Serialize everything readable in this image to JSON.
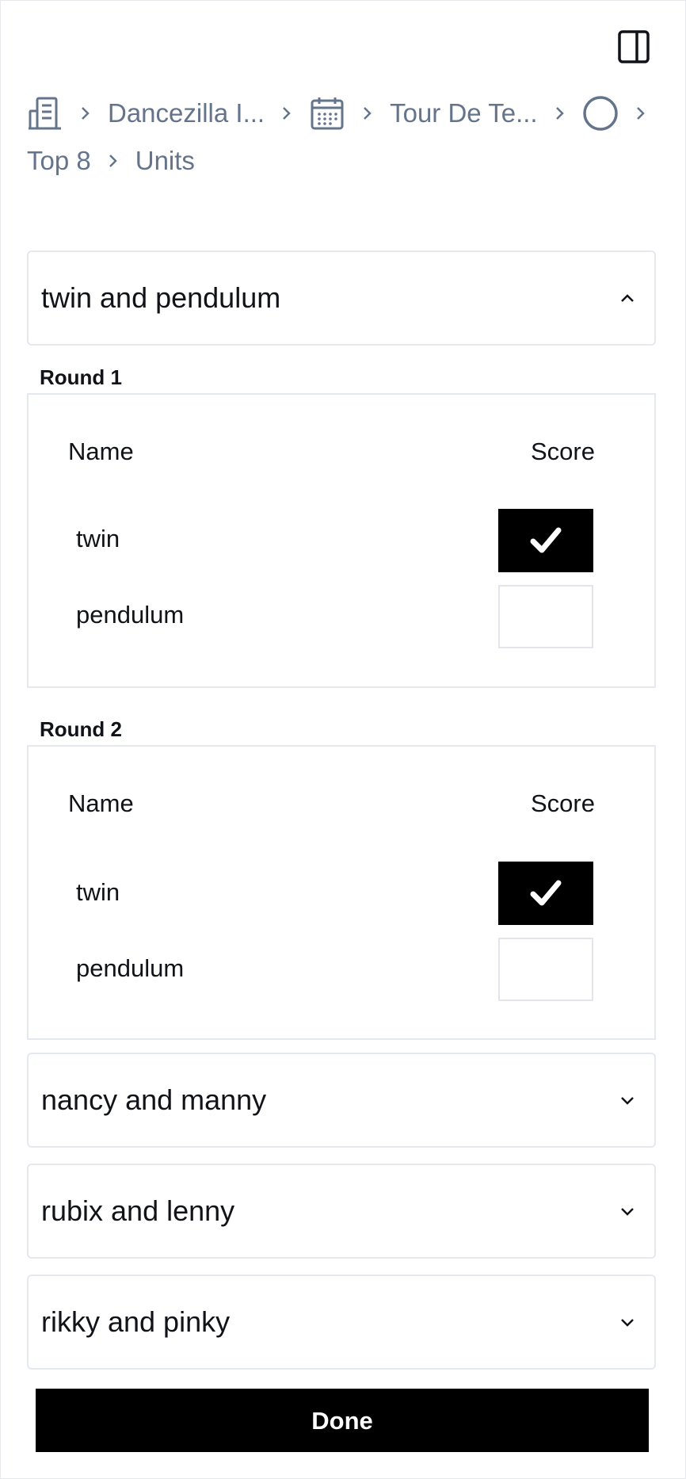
{
  "breadcrumb": {
    "items": [
      {
        "icon": "building-icon",
        "label": "Dancezilla I..."
      },
      {
        "icon": "calendar-icon",
        "label": "Tour De Te..."
      },
      {
        "icon": "circle-icon",
        "label": ""
      },
      {
        "icon": "",
        "label": "Top 8"
      },
      {
        "icon": "",
        "label": "Units"
      }
    ]
  },
  "units": [
    {
      "title": "twin and pendulum",
      "expanded": true,
      "rounds": [
        {
          "label": "Round 1",
          "columns": {
            "name": "Name",
            "score": "Score"
          },
          "rows": [
            {
              "name": "twin",
              "checked": true
            },
            {
              "name": "pendulum",
              "checked": false
            }
          ]
        },
        {
          "label": "Round 2",
          "columns": {
            "name": "Name",
            "score": "Score"
          },
          "rows": [
            {
              "name": "twin",
              "checked": true
            },
            {
              "name": "pendulum",
              "checked": false
            }
          ]
        }
      ]
    },
    {
      "title": "nancy and manny",
      "expanded": false
    },
    {
      "title": "rubix and lenny",
      "expanded": false
    },
    {
      "title": "rikky and pinky",
      "expanded": false
    }
  ],
  "actions": {
    "done_label": "Done"
  },
  "colors": {
    "accent": "#000000",
    "muted_text": "#64748b",
    "border": "#e6e8ef"
  }
}
